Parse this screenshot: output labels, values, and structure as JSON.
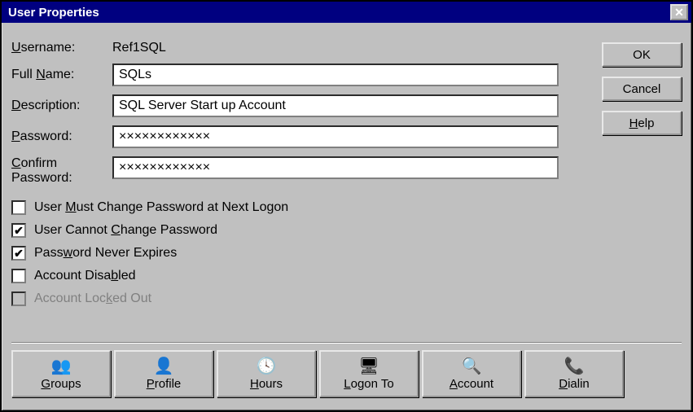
{
  "window": {
    "title": "User Properties",
    "close_glyph": "✕"
  },
  "fields": {
    "username_label_pre": "",
    "username_label_u": "U",
    "username_label_post": "sername:",
    "username_value": "Ref1SQL",
    "fullname_label_pre": "Full ",
    "fullname_label_u": "N",
    "fullname_label_post": "ame:",
    "fullname_value": "SQLs",
    "description_label_u": "D",
    "description_label_post": "escription:",
    "description_value": "SQL Server Start up Account",
    "password_label_u": "P",
    "password_label_post": "assword:",
    "password_value": "××××××××××××",
    "confirm_label_u": "C",
    "confirm_label_post": "onfirm\nPassword:",
    "confirm_value": "××××××××××××"
  },
  "buttons": {
    "ok": "OK",
    "cancel": "Cancel",
    "help_u": "H",
    "help_post": "elp"
  },
  "checkboxes": [
    {
      "pre": "User ",
      "u": "M",
      "post": "ust Change Password at Next Logon",
      "checked": false,
      "disabled": false
    },
    {
      "pre": "User Cannot ",
      "u": "C",
      "post": "hange Password",
      "checked": true,
      "disabled": false
    },
    {
      "pre": "Pass",
      "u": "w",
      "post": "ord Never Expires",
      "checked": true,
      "disabled": false
    },
    {
      "pre": "Account Disa",
      "u": "b",
      "post": "led",
      "checked": false,
      "disabled": false
    },
    {
      "pre": "Account Loc",
      "u": "k",
      "post": "ed Out",
      "checked": false,
      "disabled": true
    }
  ],
  "toolbar": [
    {
      "icon": "👥",
      "u": "G",
      "post": "roups",
      "name": "groups"
    },
    {
      "icon": "👤",
      "u": "P",
      "post": "rofile",
      "name": "profile"
    },
    {
      "icon": "🕓",
      "u": "H",
      "post": "ours",
      "name": "hours"
    },
    {
      "icon": "🖥",
      "pre": "",
      "u": "L",
      "post": "ogon To",
      "name": "logon-to"
    },
    {
      "icon": "🔍",
      "u": "A",
      "post": "ccount",
      "name": "account"
    },
    {
      "icon": "📞",
      "u": "D",
      "post": "ialin",
      "name": "dialin"
    }
  ]
}
